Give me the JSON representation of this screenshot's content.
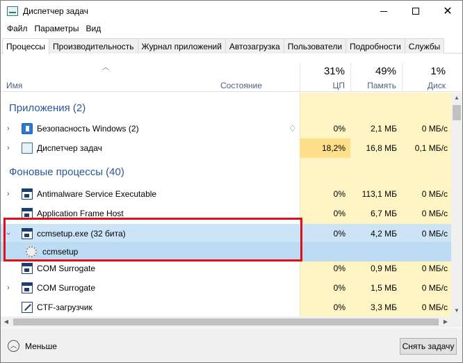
{
  "window": {
    "title": "Диспетчер задач"
  },
  "window_controls": {
    "minimize": "",
    "maximize": "",
    "close": "✕"
  },
  "menu": [
    "Файл",
    "Параметры",
    "Вид"
  ],
  "tabs": [
    "Процессы",
    "Производительность",
    "Журнал приложений",
    "Автозагрузка",
    "Пользователи",
    "Подробности",
    "Службы"
  ],
  "active_tab": "Процессы",
  "columns": {
    "name": "Имя",
    "status": "Состояние",
    "cpu": {
      "pct": "31%",
      "label": "ЦП"
    },
    "memory": {
      "pct": "49%",
      "label": "Память"
    },
    "disk": {
      "pct": "1%",
      "label": "Диск"
    }
  },
  "groups": {
    "apps": "Приложения (2)",
    "background": "Фоновые процессы (40)"
  },
  "rows": [
    {
      "name": "Безопасность Windows (2)",
      "cpu": "0%",
      "mem": "2,1 МБ",
      "disk": "0 МБ/с",
      "icon": "shield-icon"
    },
    {
      "name": "Диспетчер задач",
      "cpu": "18,2%",
      "mem": "16,8 МБ",
      "disk": "0,1 МБ/с",
      "icon": "task-manager-icon"
    },
    {
      "name": "Antimalware Service Executable",
      "cpu": "0%",
      "mem": "113,1 МБ",
      "disk": "0 МБ/с",
      "icon": "window-icon"
    },
    {
      "name": "Application Frame Host",
      "cpu": "0%",
      "mem": "6,7 МБ",
      "disk": "0 МБ/с",
      "icon": "window-icon"
    },
    {
      "name": "ccmsetup.exe (32 бита)",
      "cpu": "0%",
      "mem": "4,2 МБ",
      "disk": "0 МБ/с",
      "icon": "window-icon"
    },
    {
      "name": "ccmsetup",
      "cpu": "",
      "mem": "",
      "disk": "",
      "icon": "gear-icon"
    },
    {
      "name": "COM Surrogate",
      "cpu": "0%",
      "mem": "0,9 МБ",
      "disk": "0 МБ/с",
      "icon": "window-icon"
    },
    {
      "name": "COM Surrogate",
      "cpu": "0%",
      "mem": "1,5 МБ",
      "disk": "0 МБ/с",
      "icon": "window-icon"
    },
    {
      "name": "CTF-загрузчик",
      "cpu": "0%",
      "mem": "3,3 МБ",
      "disk": "0 МБ/с",
      "icon": "ctf-loader-icon"
    }
  ],
  "footer": {
    "less_label": "Меньше",
    "end_task": "Снять задачу"
  },
  "colors": {
    "highlight_box": "#e0101a",
    "selection": "#cce4f7",
    "column_fill": "#fff4c4",
    "cpu_hot": "#ffe08a",
    "group_title": "#2b5797"
  }
}
